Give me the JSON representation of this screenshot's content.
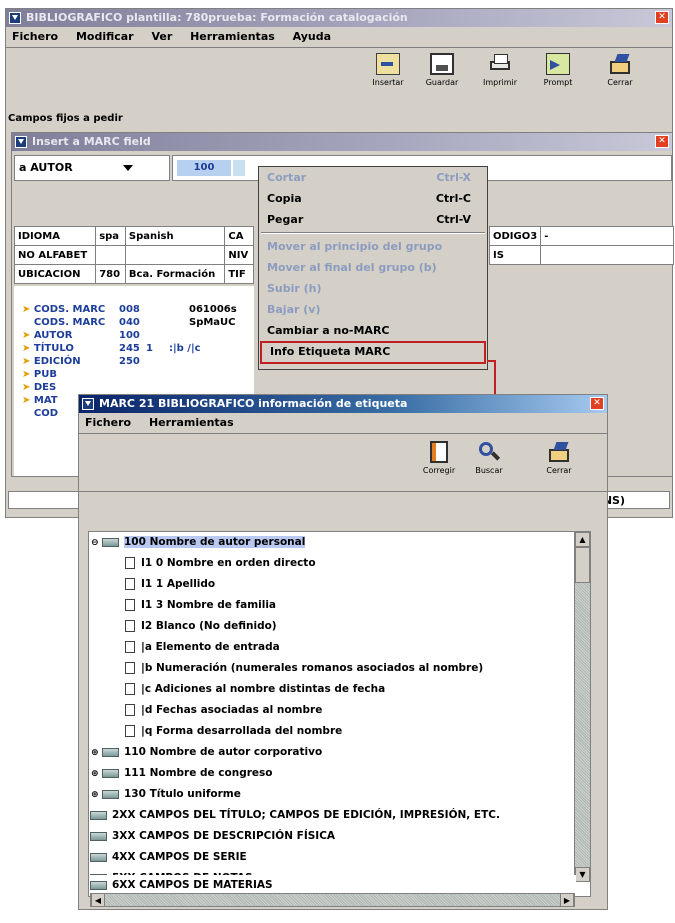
{
  "main_window": {
    "title": "BIBLIOGRAFICO plantilla: 780prueba: Formación catalogación",
    "menu": [
      "Fichero",
      "Modificar",
      "Ver",
      "Herramientas",
      "Ayuda"
    ],
    "toolbar": [
      "Insertar",
      "Guardar",
      "Imprimir",
      "Prompt",
      "Cerrar"
    ],
    "fixed_fields_label": "Campos fijos a pedir",
    "status_right": "INS)"
  },
  "insert_dialog": {
    "title": "Insert a MARC field",
    "field_select": "a AUTOR",
    "tag": "100",
    "fixed_rows": [
      [
        "IDIOMA",
        "spa",
        "Spanish",
        "CA"
      ],
      [
        "NO ALFABET",
        "",
        "",
        "NIV"
      ],
      [
        "UBICACION",
        "780",
        "Bca. Formación",
        "TIF"
      ]
    ],
    "fixed_right": [
      [
        "ODIGO3",
        "-"
      ],
      [
        "IS",
        ""
      ]
    ],
    "fields": [
      {
        "label": "CODS. MARC",
        "tag": "008",
        "ind": "",
        "data": "061006s"
      },
      {
        "label": "CODS. MARC",
        "tag": "040",
        "ind": "",
        "data": "SpMaUC"
      },
      {
        "label": "AUTOR",
        "tag": "100",
        "ind": "",
        "data": ""
      },
      {
        "label": "TÍTULO",
        "tag": "245",
        "ind": "1",
        "data": ":|b /|c"
      },
      {
        "label": "EDICIÓN",
        "tag": "250",
        "ind": "",
        "data": ""
      },
      {
        "label": "PUB",
        "tag": "",
        "ind": "",
        "data": ""
      },
      {
        "label": "DES",
        "tag": "",
        "ind": "",
        "data": ""
      },
      {
        "label": "MAT",
        "tag": "",
        "ind": "",
        "data": ""
      },
      {
        "label": "COD",
        "tag": "",
        "ind": "",
        "data": ""
      }
    ]
  },
  "context_menu": {
    "items": [
      {
        "label": "Cortar",
        "shortcut": "Ctrl-X",
        "disabled": true
      },
      {
        "label": "Copia",
        "shortcut": "Ctrl-C",
        "disabled": false
      },
      {
        "label": "Pegar",
        "shortcut": "Ctrl-V",
        "disabled": false
      },
      {
        "label": "Mover al principio del grupo",
        "shortcut": "",
        "disabled": true
      },
      {
        "label": "Mover al final del grupo (b)",
        "shortcut": "",
        "disabled": true
      },
      {
        "label": "Subir (h)",
        "shortcut": "",
        "disabled": true
      },
      {
        "label": "Bajar (v)",
        "shortcut": "",
        "disabled": true
      },
      {
        "label": "Cambiar a no-MARC",
        "shortcut": "",
        "disabled": false
      },
      {
        "label": "Info Etiqueta MARC",
        "shortcut": "",
        "disabled": false,
        "highlighted": true
      }
    ]
  },
  "info_window": {
    "title": "MARC 21 BIBLIOGRAFICO información de etiqueta",
    "menu": [
      "Fichero",
      "Herramientas"
    ],
    "toolbar": [
      "Corregir",
      "Buscar",
      "Cerrar"
    ],
    "tree": [
      {
        "text": "100 Nombre de autor personal",
        "kind": "folder",
        "toggle": "open",
        "selected": true
      },
      {
        "text": "I1 0 Nombre en orden directo",
        "kind": "doc"
      },
      {
        "text": "I1 1 Apellido",
        "kind": "doc"
      },
      {
        "text": "I1 3 Nombre de familia",
        "kind": "doc"
      },
      {
        "text": "I2 Blanco (No definido)",
        "kind": "doc"
      },
      {
        "text": "|a Elemento de entrada",
        "kind": "doc"
      },
      {
        "text": "|b Numeración (numerales romanos asociados al nombre)",
        "kind": "doc"
      },
      {
        "text": "|c Adiciones al nombre distintas de fecha",
        "kind": "doc"
      },
      {
        "text": "|d Fechas asociadas al nombre",
        "kind": "doc"
      },
      {
        "text": "|q Forma desarrollada del nombre",
        "kind": "doc"
      },
      {
        "text": "110 Nombre de autor corporativo",
        "kind": "folder",
        "toggle": "closed"
      },
      {
        "text": "111 Nombre de congreso",
        "kind": "folder",
        "toggle": "closed"
      },
      {
        "text": "130 Título uniforme",
        "kind": "folder",
        "toggle": "closed"
      },
      {
        "text": "2XX CAMPOS DEL TÍTULO; CAMPOS DE EDICIÓN, IMPRESIÓN, ETC.",
        "kind": "root"
      },
      {
        "text": "3XX CAMPOS DE DESCRIPCIÓN FÍSICA",
        "kind": "root"
      },
      {
        "text": "4XX CAMPOS DE SERIE",
        "kind": "root"
      },
      {
        "text": "5XX CAMPOS DE NOTAS",
        "kind": "root"
      },
      {
        "text": "6XX CAMPOS DE MATERIAS",
        "kind": "root"
      }
    ]
  }
}
